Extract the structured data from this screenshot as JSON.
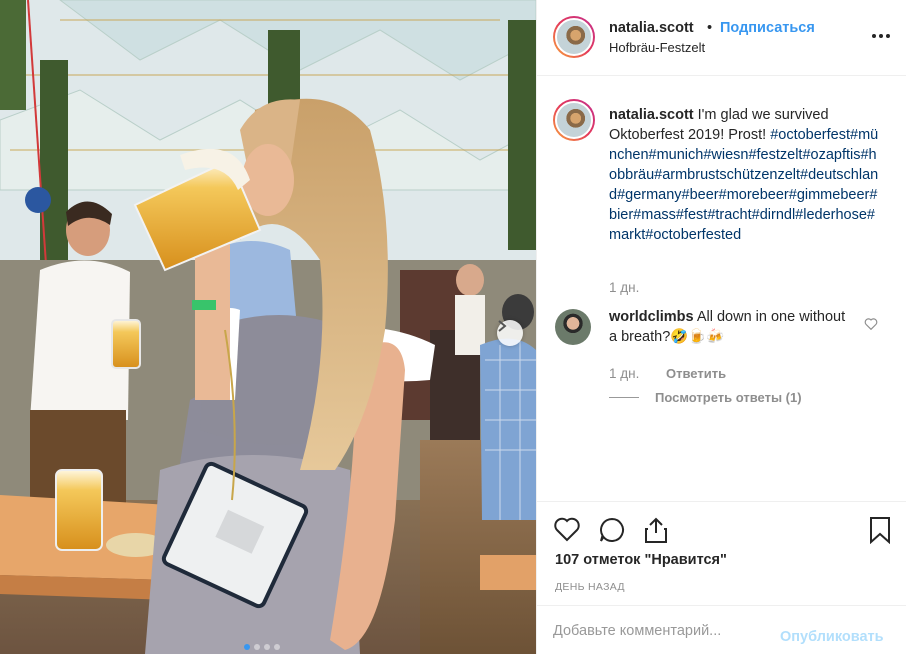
{
  "post": {
    "username": "natalia.scott",
    "separator": "•",
    "follow_label": "Подписаться",
    "location": "Hofbräu-Festzelt",
    "photo_slide_count": 4,
    "photo_active_slide": 1
  },
  "caption": {
    "username": "natalia.scott",
    "text": " I'm glad we survived Oktoberfest 2019! Prost!",
    "hashtags": "#octoberfest#münchen#munich#wiesn#festzelt#ozapftis#hobbräu#armbrustschützenzelt#deutschland#germany#beer#morebeer#gimmebeer#bier#mass#fest#tracht#dirndl#lederhose#markt#octoberfested",
    "time": "1 дн."
  },
  "comment": {
    "username": "worldclimbs",
    "text": " All down in one without a breath?🤣🍺🍻",
    "time": "1 дн.",
    "reply_label": "Ответить",
    "view_replies_label": "Посмотреть ответы (1)"
  },
  "actions": {
    "likes_label": "107 отметок \"Нравится\"",
    "date_label": "ДЕНЬ НАЗАД"
  },
  "add_comment": {
    "placeholder": "Добавьте комментарий...",
    "publish_label": "Опубликовать"
  },
  "colors": {
    "link_blue": "#3897f0",
    "hashtag_blue": "#003569",
    "muted_gray": "#8e8e8e",
    "publish_disabled": "#b2dffc"
  },
  "icons": [
    "more-options-icon",
    "heart-icon",
    "comment-icon",
    "share-icon",
    "bookmark-icon",
    "chevron-right-icon"
  ]
}
